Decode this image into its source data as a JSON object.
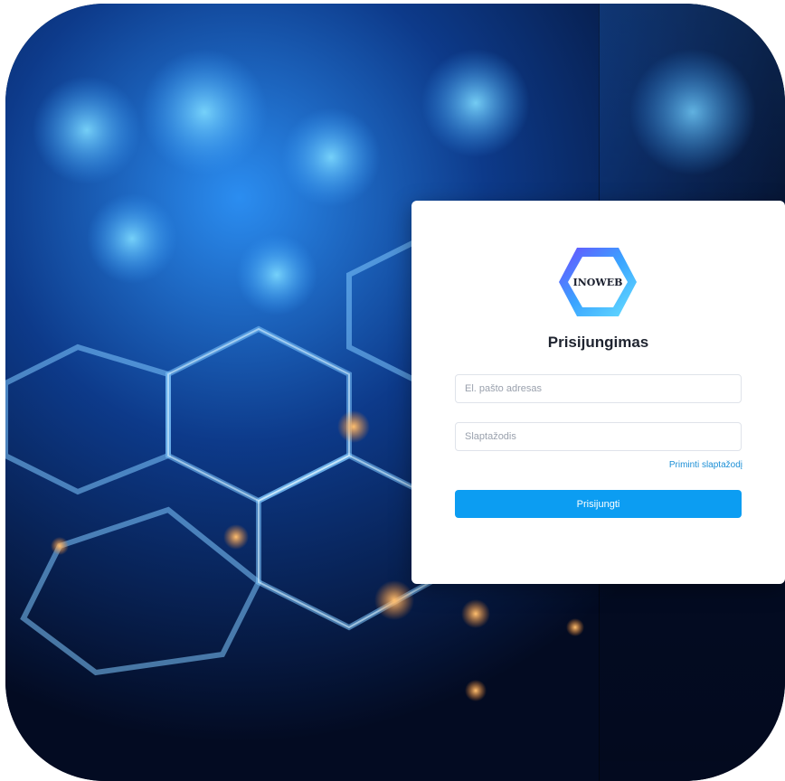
{
  "background": {
    "image": "hexagon-network-bokeh",
    "colors": {
      "deep": "#05122e",
      "blue": "#1d6fe0",
      "glow": "#4fc3ff",
      "amber": "#ffa64a"
    }
  },
  "login": {
    "logo_text": "INOWEB",
    "title": "Prisijungimas",
    "email_placeholder": "El. pašto adresas",
    "password_placeholder": "Slaptažodis",
    "forgot_link": "Priminti slaptažodį",
    "submit_label": "Prisijungti"
  },
  "colors": {
    "accent": "#0c9df2",
    "link": "#1c8fd6",
    "title": "#1f2430"
  }
}
